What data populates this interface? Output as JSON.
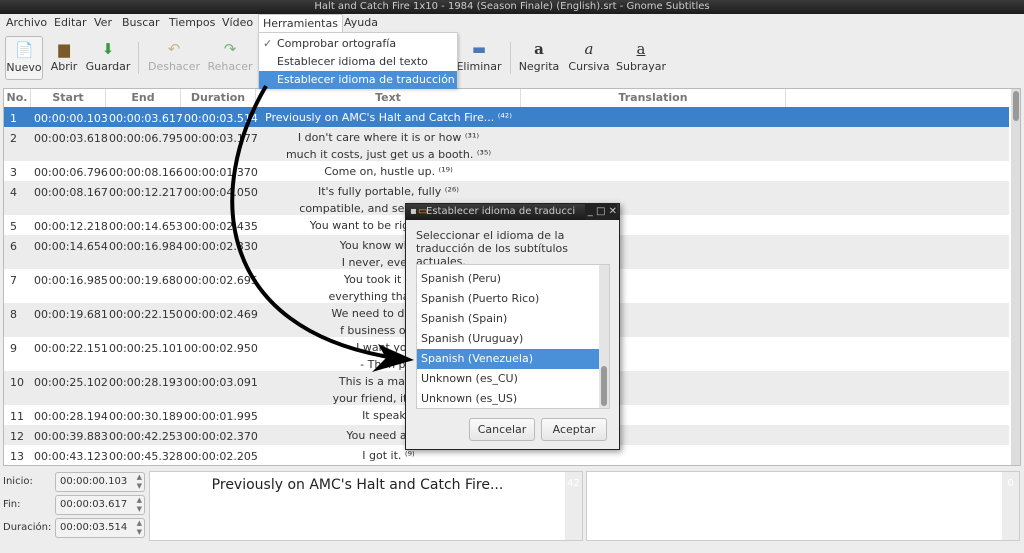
{
  "window": {
    "title": "Halt and Catch Fire 1x10 - 1984 (Season Finale) (English).srt - Gnome Subtitles"
  },
  "menubar": [
    "Archivo",
    "Editar",
    "Ver",
    "Buscar",
    "Tiempos",
    "Vídeo",
    "Herramientas",
    "Ayuda"
  ],
  "toolbar": {
    "new": "Nuevo",
    "open": "Abrir",
    "save": "Guardar",
    "undo": "Deshacer",
    "redo": "Rehacer",
    "delete": "Eliminar",
    "bold": "Negrita",
    "italic": "Cursiva",
    "underline": "Subrayar"
  },
  "tools_menu": {
    "items": [
      {
        "label": "Comprobar ortografía",
        "checked": true
      },
      {
        "label": "Establecer idioma del texto"
      },
      {
        "label": "Establecer idioma de traducción",
        "highlighted": true
      }
    ]
  },
  "table": {
    "columns": [
      "No.",
      "Start",
      "End",
      "Duration",
      "Text",
      "Translation"
    ],
    "rows": [
      {
        "no": "1",
        "start": "00:00:00.103",
        "end": "00:00:03.617",
        "duration": "00:00:03.514",
        "text": [
          "Previously on AMC's Halt and Catch Fire... ⁽⁴²⁾"
        ]
      },
      {
        "no": "2",
        "start": "00:00:03.618",
        "end": "00:00:06.795",
        "duration": "00:00:03.177",
        "text": [
          "I don't care where it is or how ⁽³¹⁾",
          "much it costs, just get us a booth. ⁽³⁵⁾"
        ]
      },
      {
        "no": "3",
        "start": "00:00:06.796",
        "end": "00:00:08.166",
        "duration": "00:00:01.370",
        "text": [
          "Come on, hustle up. ⁽¹⁹⁾"
        ]
      },
      {
        "no": "4",
        "start": "00:00:08.167",
        "end": "00:00:12.217",
        "duration": "00:00:04.050",
        "text": [
          "It's fully portable, fully ⁽²⁶⁾",
          "compatible, and sexy as hell. ⁽²⁹⁾"
        ]
      },
      {
        "no": "5",
        "start": "00:00:12.218",
        "end": "00:00:14.653",
        "duration": "00:00:02.435",
        "text": [
          "You want to be right more th"
        ]
      },
      {
        "no": "6",
        "start": "00:00:14.654",
        "end": "00:00:16.984",
        "duration": "00:00:02.330",
        "text": [
          "You know what, D",
          "I never, ever gav"
        ]
      },
      {
        "no": "7",
        "start": "00:00:16.985",
        "end": "00:00:19.680",
        "duration": "00:00:02.695",
        "text": [
          "You took it out. I",
          "everything that made"
        ]
      },
      {
        "no": "8",
        "start": "00:00:19.681",
        "end": "00:00:22.150",
        "duration": "00:00:02.469",
        "text": [
          "We need to demo by",
          "f business or we'r"
        ]
      },
      {
        "no": "9",
        "start": "00:00:22.151",
        "end": "00:00:25.101",
        "duration": "00:00:02.950",
        "text": [
          "- I want you th",
          "- Then put"
        ]
      },
      {
        "no": "10",
        "start": "00:00:25.102",
        "end": "00:00:28.193",
        "duration": "00:00:03.091",
        "text": [
          "This is a machine,",
          "your friend, it's your"
        ]
      },
      {
        "no": "11",
        "start": "00:00:28.194",
        "end": "00:00:30.189",
        "duration": "00:00:01.995",
        "text": [
          "It speaks."
        ]
      },
      {
        "no": "12",
        "start": "00:00:39.883",
        "end": "00:00:42.253",
        "duration": "00:00:02.370",
        "text": [
          "You need any h"
        ]
      },
      {
        "no": "13",
        "start": "00:00:43.123",
        "end": "00:00:45.328",
        "duration": "00:00:02.205",
        "text": [
          "I got it. ⁽⁹⁾"
        ]
      }
    ]
  },
  "dialog": {
    "title": "Establecer idioma de traducci",
    "label": "Seleccionar el idioma de la traducción de los subtítulos actuales.",
    "languages": [
      "Spanish (Peru)",
      "Spanish (Puerto Rico)",
      "Spanish (Spain)",
      "Spanish (Uruguay)",
      "Spanish (Venezuela)",
      "Unknown (es_CU)",
      "Unknown (es_US)"
    ],
    "selected": "Spanish (Venezuela)",
    "cancel": "Cancelar",
    "accept": "Aceptar"
  },
  "editor": {
    "start_label": "Inicio:",
    "end_label": "Fin:",
    "duration_label": "Duración:",
    "start": "00:00:00.103",
    "end": "00:00:03.617",
    "duration": "00:00:03.514",
    "text": "Previously on AMC's Halt and Catch Fire...",
    "text_count": "42",
    "translation_count": "0"
  },
  "colors": {
    "selection": "#3a80cb",
    "menu_highlight": "#4a90d9"
  }
}
